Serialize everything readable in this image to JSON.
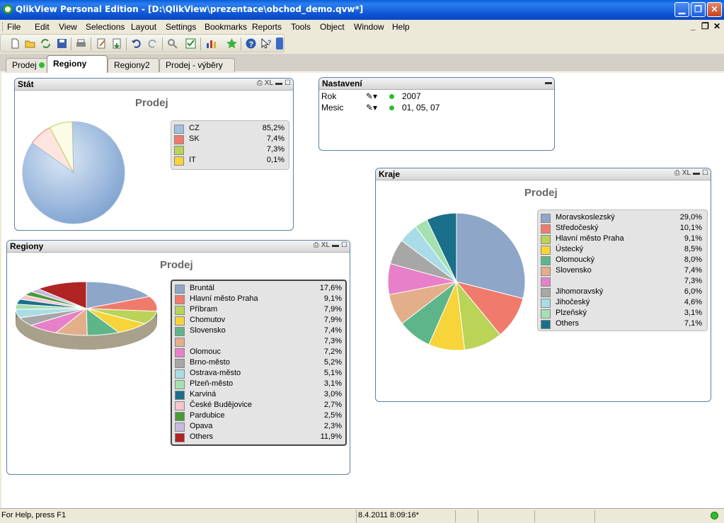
{
  "window": {
    "title": "QlikView Personal Edition - [D:\\QlikView\\prezentace\\obchod_demo.qvw*]"
  },
  "menu": [
    "File",
    "Edit",
    "View",
    "Selections",
    "Layout",
    "Settings",
    "Bookmarks",
    "Reports",
    "Tools",
    "Object",
    "Window",
    "Help"
  ],
  "toolbar_icons": [
    "new-file-icon",
    "open-folder-icon",
    "reload-icon",
    "save-icon",
    "print-icon",
    "edit-script-icon",
    "reload-data-icon",
    "undo-icon",
    "redo-icon",
    "search-icon",
    "select-icon",
    "new-chart-icon",
    "bookmark-star-icon",
    "help-icon",
    "context-help-icon"
  ],
  "tabs": [
    {
      "label": "Prodej",
      "active": false,
      "dot": true
    },
    {
      "label": "Regiony",
      "active": true
    },
    {
      "label": "Regiony2",
      "active": false
    },
    {
      "label": "Prodej - výběry",
      "active": false
    }
  ],
  "stat_box": {
    "caption": "Stát",
    "chart_title": "Prodej",
    "legend": [
      {
        "label": "CZ",
        "value": "85,2%",
        "color": "#a3bfe0"
      },
      {
        "label": "SK",
        "value": "7,4%",
        "color": "#f07b6c"
      },
      {
        "label": "",
        "value": "7,3%",
        "color": "#b9d456"
      },
      {
        "label": "IT",
        "value": "0,1%",
        "color": "#f6d43a"
      }
    ]
  },
  "nastaveni_box": {
    "caption": "Nastavení",
    "rows": [
      {
        "label": "Rok",
        "value": "2007"
      },
      {
        "label": "Mesic",
        "value": "01, 05, 07"
      }
    ]
  },
  "kraje_box": {
    "caption": "Kraje",
    "chart_title": "Prodej",
    "legend": [
      {
        "label": "Moravskoslezský",
        "value": "29,0%",
        "color": "#8ea6c8"
      },
      {
        "label": "Středočeský",
        "value": "10,1%",
        "color": "#f07b6c"
      },
      {
        "label": "Hlavní město Praha",
        "value": "9,1%",
        "color": "#b9d456"
      },
      {
        "label": "Ústecký",
        "value": "8,5%",
        "color": "#f6d43a"
      },
      {
        "label": "Olomoucký",
        "value": "8,0%",
        "color": "#5fb58a"
      },
      {
        "label": "Slovensko",
        "value": "7,4%",
        "color": "#e3ae8a"
      },
      {
        "label": "",
        "value": "7,3%",
        "color": "#e780c9"
      },
      {
        "label": "Jihomoravský",
        "value": "6,0%",
        "color": "#a7a7a7"
      },
      {
        "label": "Jihočeský",
        "value": "4,6%",
        "color": "#a9dce6"
      },
      {
        "label": "Plzeňský",
        "value": "3,1%",
        "color": "#a5e0b0"
      },
      {
        "label": "Others",
        "value": "7,1%",
        "color": "#1a6f8a"
      }
    ]
  },
  "regiony_box": {
    "caption": "Regiony",
    "chart_title": "Prodej",
    "legend": [
      {
        "label": "Bruntál",
        "value": "17,6%",
        "color": "#8ea6c8"
      },
      {
        "label": "Hlavní město Praha",
        "value": "9,1%",
        "color": "#f07b6c"
      },
      {
        "label": "Příbram",
        "value": "7,9%",
        "color": "#b9d456"
      },
      {
        "label": "Chomutov",
        "value": "7,9%",
        "color": "#f6d43a"
      },
      {
        "label": "Slovensko",
        "value": "7,4%",
        "color": "#5fb58a"
      },
      {
        "label": "",
        "value": "7,3%",
        "color": "#e3ae8a"
      },
      {
        "label": "Olomouc",
        "value": "7,2%",
        "color": "#e780c9"
      },
      {
        "label": "Brno-město",
        "value": "5,2%",
        "color": "#a7a7a7"
      },
      {
        "label": "Ostrava-město",
        "value": "5,1%",
        "color": "#a9dce6"
      },
      {
        "label": "Plzeň-město",
        "value": "3,1%",
        "color": "#a5e0b0"
      },
      {
        "label": "Karviná",
        "value": "3,0%",
        "color": "#1a6f8a"
      },
      {
        "label": "České Budějovice",
        "value": "2,7%",
        "color": "#f5c4cc"
      },
      {
        "label": "Pardubice",
        "value": "2,5%",
        "color": "#4a9a3a"
      },
      {
        "label": "Opava",
        "value": "2,3%",
        "color": "#c8b8e0"
      },
      {
        "label": "Others",
        "value": "11,9%",
        "color": "#b02424"
      }
    ]
  },
  "status": {
    "help": "For Help, press F1",
    "datetime": "8.4.2011 8:09:16*"
  }
}
